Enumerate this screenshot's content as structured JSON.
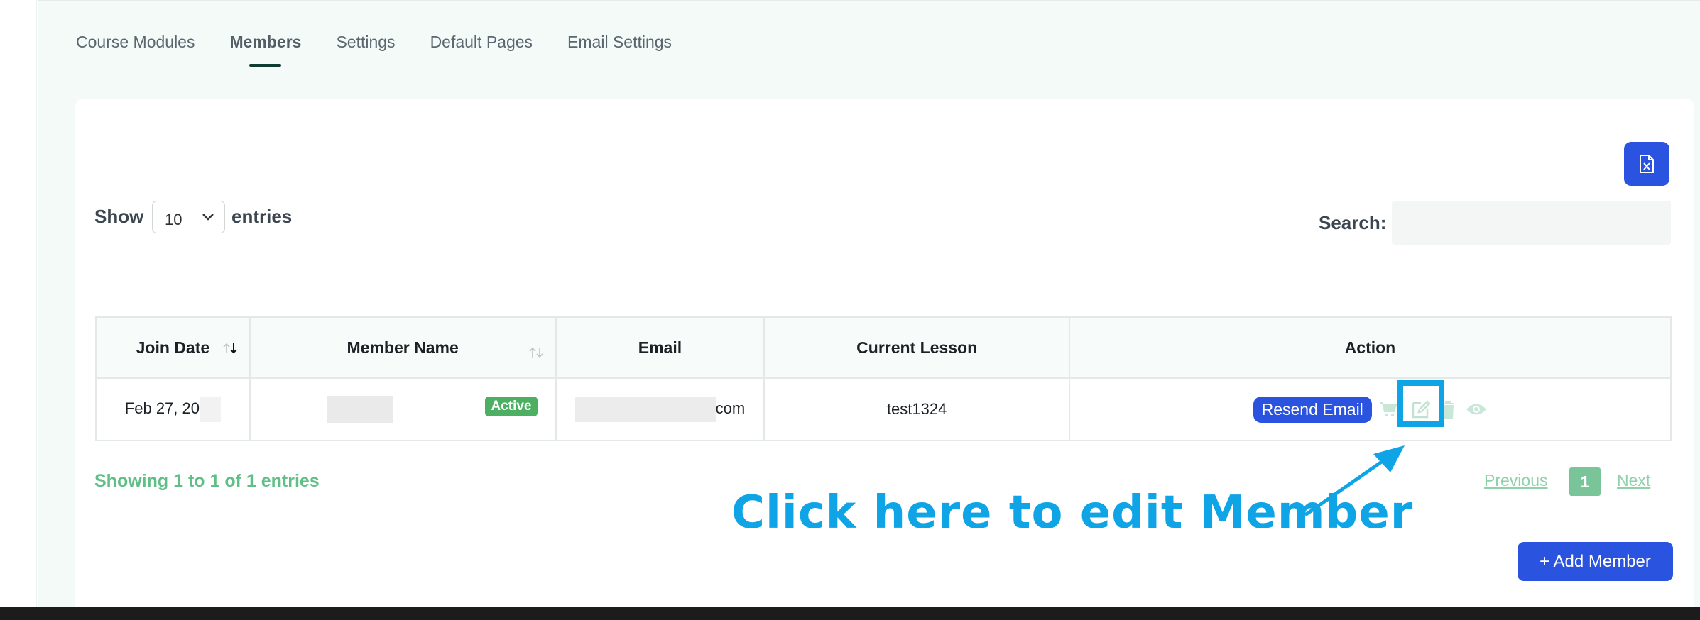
{
  "tabs": [
    {
      "label": "Course Modules",
      "active": false
    },
    {
      "label": "Members",
      "active": true
    },
    {
      "label": "Settings",
      "active": false
    },
    {
      "label": "Default Pages",
      "active": false
    },
    {
      "label": "Email Settings",
      "active": false
    }
  ],
  "controls": {
    "show_label": "Show",
    "entries_value": "10",
    "entries_label": "entries",
    "search_label": "Search:",
    "search_value": "",
    "export_icon": "excel-file-icon"
  },
  "table": {
    "headers": [
      "Join Date",
      "Member Name",
      "Email",
      "Current Lesson",
      "Action"
    ],
    "rows": [
      {
        "join_date": "Feb 27, 20",
        "status": "Active",
        "email_suffix": "com",
        "lesson": "test1324",
        "resend_label": "Resend Email"
      }
    ]
  },
  "footer": {
    "showing": "Showing 1 to 1 of 1 entries",
    "previous": "Previous",
    "page": "1",
    "next": "Next",
    "add_member": "+ Add Member"
  },
  "annotation": "Click here to edit Member",
  "colors": {
    "primary": "#2a53e0",
    "active_badge": "#4caf61",
    "annotation": "#0ea4e6",
    "pager": "#79c599"
  }
}
